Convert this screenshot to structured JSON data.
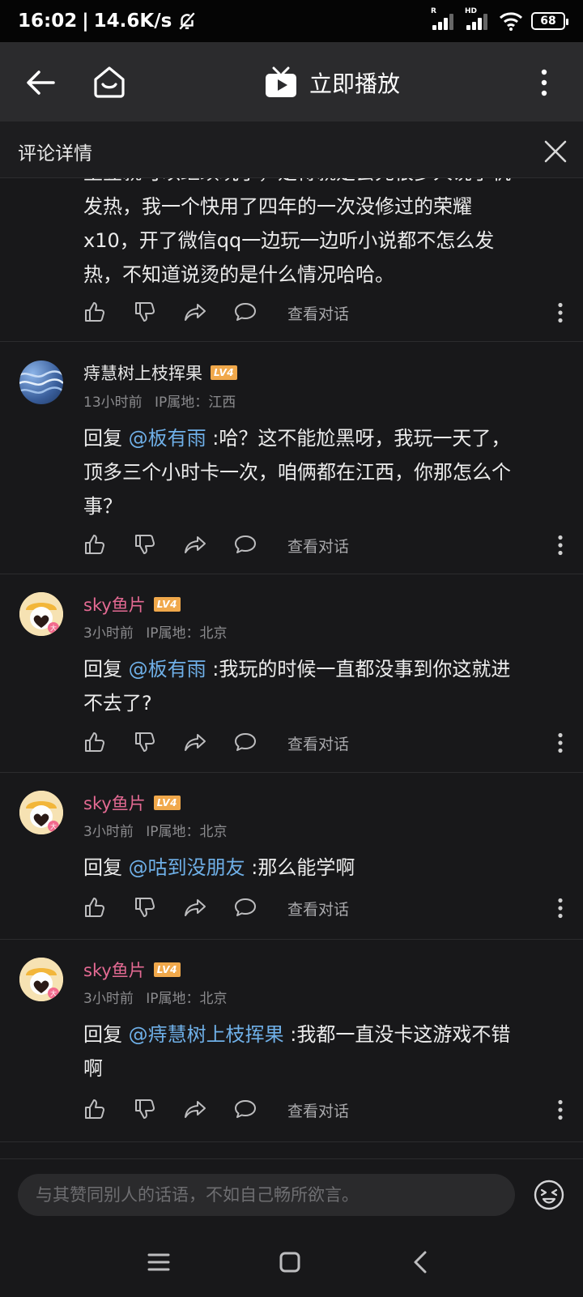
{
  "status_bar": {
    "time": "16:02",
    "speed": "14.6K/s",
    "battery": "68",
    "signal1_label": "R",
    "signal2_label": "HD"
  },
  "top_nav": {
    "play_label": "立即播放"
  },
  "sub_header": {
    "title": "评论详情"
  },
  "comments": [
    {
      "text_lines": [
        "里豆就可以继续玩了，是得就是会先很多人说手机",
        "发热，我一个快用了四年的一次没修过的荣耀",
        "x10，开了微信qq一边玩一边听小说都不怎么发",
        "热，不知道说烫的是什么情况哈哈。"
      ],
      "view_label": "查看对话"
    },
    {
      "username": "痔慧树上枝挥果",
      "level": "LV4",
      "time": "13小时前",
      "ip": "IP属地：江西",
      "reply_prefix": "回复 ",
      "mention": "@板有雨",
      "text_first": " :哈？这不能尬黑呀，我玩一天了，",
      "text_lines": [
        "顶多三个小时卡一次，咱俩都在江西，你那怎么个",
        "事？"
      ],
      "view_label": "查看对话"
    },
    {
      "username": "sky鱼片",
      "level": "LV4",
      "time": "3小时前",
      "ip": "IP属地：北京",
      "reply_prefix": "回复 ",
      "mention": "@板有雨",
      "text_first": " :我玩的时候一直都没事到你这就进",
      "text_lines": [
        "不去了?"
      ],
      "view_label": "查看对话"
    },
    {
      "username": "sky鱼片",
      "level": "LV4",
      "time": "3小时前",
      "ip": "IP属地：北京",
      "reply_prefix": "回复 ",
      "mention": "@咕到没朋友",
      "text_first": " :那么能学啊",
      "text_lines": [],
      "view_label": "查看对话"
    },
    {
      "username": "sky鱼片",
      "level": "LV4",
      "time": "3小时前",
      "ip": "IP属地：北京",
      "reply_prefix": "回复 ",
      "mention": "@痔慧树上枝挥果",
      "text_first": " :我都一直没卡这游戏不错",
      "text_lines": [
        "啊"
      ],
      "view_label": "查看对话"
    }
  ],
  "reply_bar": {
    "placeholder": "与其赞同别人的话语，不如自己畅所欲言。"
  },
  "colors": {
    "background": "#18181a",
    "username_default": "#e7e7e7",
    "username_pink": "#e46a93",
    "mention": "#6fb0e8",
    "level_badge": "#f0a84b"
  },
  "icons": {
    "back": "arrow-left-icon",
    "home": "home-smile-icon",
    "tv": "tv-play-icon",
    "more": "more-vertical-icon",
    "close": "close-icon",
    "like": "thumbs-up-icon",
    "dislike": "thumbs-down-icon",
    "share": "share-icon",
    "reply": "comment-bubble-icon",
    "emoji": "emoji-icon"
  }
}
